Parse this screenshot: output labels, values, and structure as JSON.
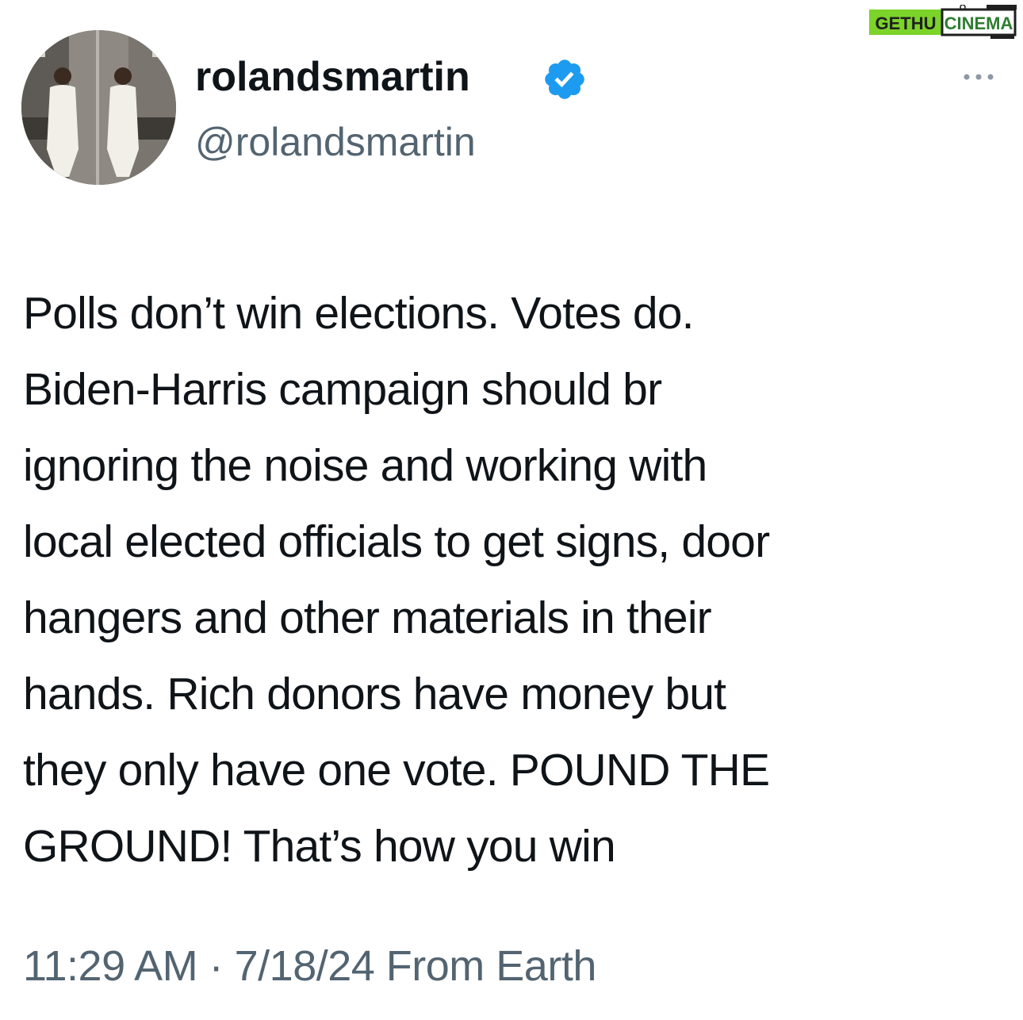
{
  "watermark": {
    "text_part1": "GETHU",
    "text_part2": "CINEMA",
    "color_part1": "#1f1f1f",
    "color_part2": "#2e7d32",
    "bg": "#7cd32a"
  },
  "author": {
    "display_name": "rolandsmartin",
    "handle": "@rolandsmartin",
    "verified": true,
    "verified_color": "#1d9bf0",
    "avatar_icon": "profile-photo"
  },
  "menu": {
    "more_icon": "ellipsis-icon"
  },
  "tweet": {
    "text": "Polls don’t win elections. Votes do.\nBiden-Harris campaign should br\nignoring the noise and working with\nlocal elected officials to get signs, door\nhangers and other materials in their\nhands. Rich donors have money but\nthey only have one vote. POUND THE\nGROUND! That’s how you win",
    "timestamp": "11:29 AM · 7/18/24 From Earth"
  },
  "colors": {
    "text": "#0f1419",
    "secondary": "#536471",
    "background": "#ffffff"
  }
}
